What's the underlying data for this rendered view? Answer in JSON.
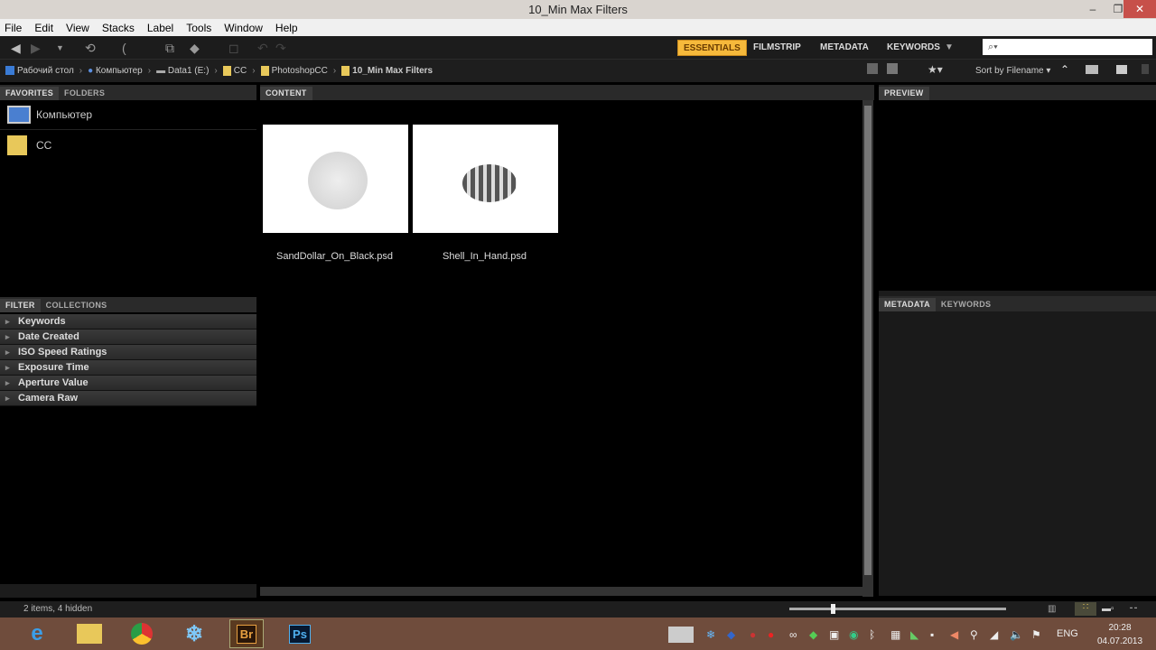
{
  "window": {
    "title": "10_Min Max Filters"
  },
  "menu": [
    "File",
    "Edit",
    "View",
    "Stacks",
    "Label",
    "Tools",
    "Window",
    "Help"
  ],
  "workspaces": {
    "essentials": "ESSENTIALS",
    "filmstrip": "FILMSTRIP",
    "metadata": "METADATA",
    "keywords": "KEYWORDS"
  },
  "search": {
    "placeholder": "",
    "icon": "search-icon"
  },
  "breadcrumb": [
    "Рабочий стол",
    "Компьютер",
    "Data1 (E:)",
    "CC",
    "PhotoshopCC",
    "10_Min Max Filters"
  ],
  "sort": {
    "label": "Sort by Filename"
  },
  "left_tabs": [
    "FAVORITES",
    "FOLDERS"
  ],
  "favorites": [
    "Компьютер",
    "CC"
  ],
  "filter_tabs": [
    "FILTER",
    "COLLECTIONS"
  ],
  "filters": [
    "Keywords",
    "Date Created",
    "ISO Speed Ratings",
    "Exposure Time",
    "Aperture Value",
    "Camera Raw"
  ],
  "content": {
    "tab": "CONTENT",
    "items": [
      {
        "name": "SandDollar_On_Black.psd"
      },
      {
        "name": "Shell_In_Hand.psd"
      }
    ]
  },
  "preview": {
    "tab": "PREVIEW"
  },
  "metadata_tabs": [
    "METADATA",
    "KEYWORDS"
  ],
  "status": {
    "text": "2 items, 4 hidden",
    "thumb_size": 0.08
  },
  "taskbar": {
    "apps": [
      "Br",
      "Ps"
    ],
    "lang": "ENG",
    "time": "20:28",
    "date": "04.07.2013"
  },
  "colors": {
    "accent": "#f6b93b",
    "taskbar": "#6f4c3c"
  }
}
